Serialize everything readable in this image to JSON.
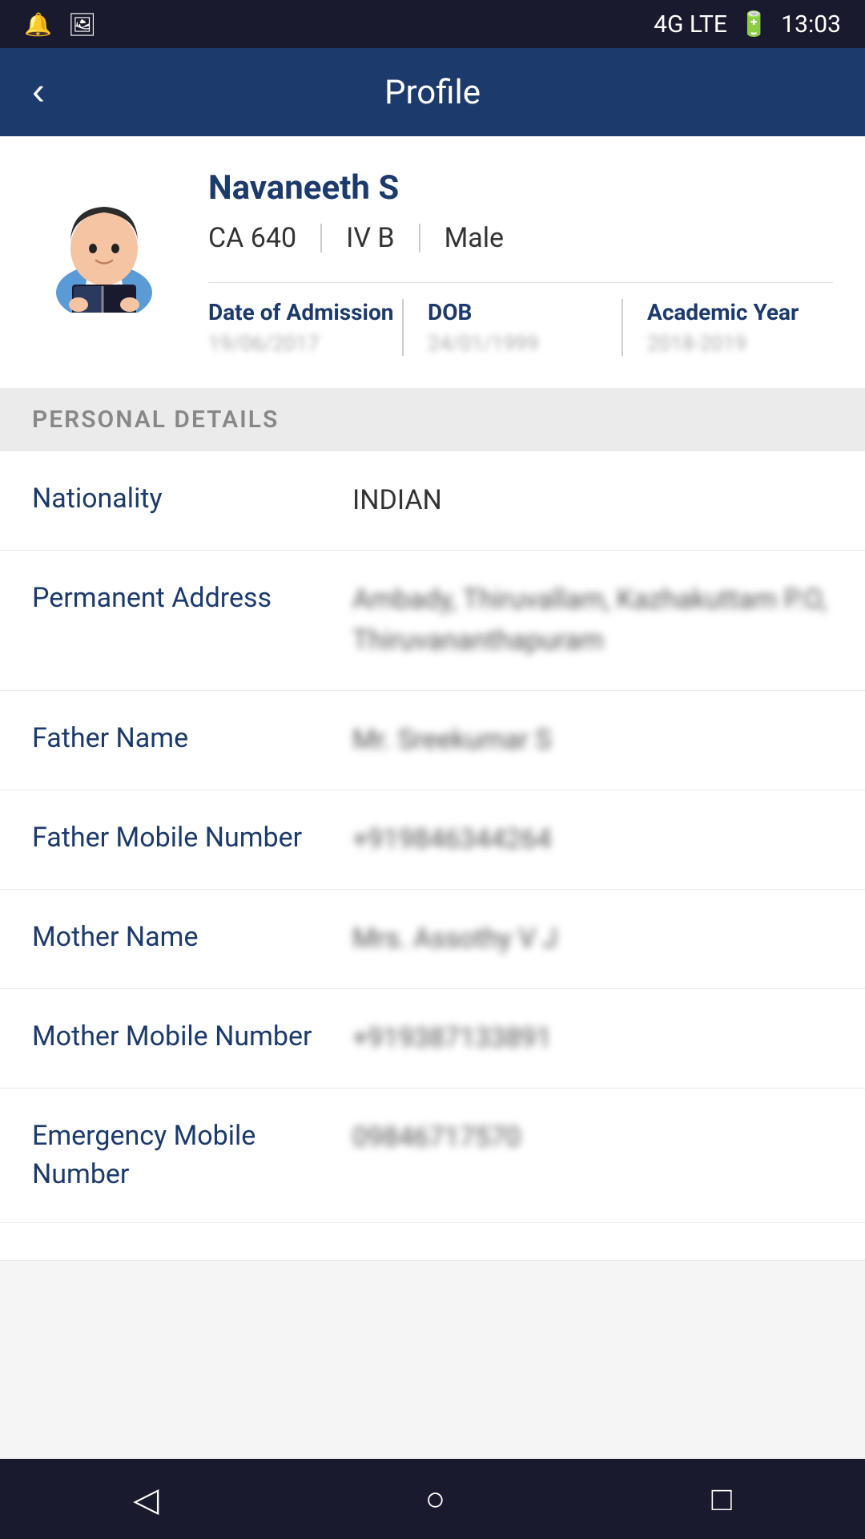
{
  "statusBar": {
    "time": "13:03",
    "signal": "4G LTE"
  },
  "appBar": {
    "title": "Profile",
    "backLabel": "‹"
  },
  "profile": {
    "name": "Navaneeth S",
    "roll": "CA 640",
    "section": "IV B",
    "gender": "Male",
    "stats": [
      {
        "label": "Date of Admission",
        "value": "19/06/2017"
      },
      {
        "label": "DOB",
        "value": "24/01/1999"
      },
      {
        "label": "Academic Year",
        "value": "2018-2019"
      }
    ]
  },
  "personalDetails": {
    "sectionTitle": "PERSONAL DETAILS",
    "rows": [
      {
        "label": "Nationality",
        "value": "INDIAN",
        "blurred": false
      },
      {
        "label": "Permanent Address",
        "value": "Ambady, Thiruvallam,\nKazhakuttam P.O,\nThiruvananthapuram",
        "blurred": true
      },
      {
        "label": "Father Name",
        "value": "Mr. Sreekumar S",
        "blurred": true
      },
      {
        "label": "Father Mobile Number",
        "value": "+919846344264",
        "blurred": true
      },
      {
        "label": "Mother Name",
        "value": "Mrs. Assothy V J",
        "blurred": true
      },
      {
        "label": "Mother Mobile Number",
        "value": "+919387133891",
        "blurred": true
      },
      {
        "label": "Emergency Mobile Number",
        "value": "09846717570",
        "blurred": true
      }
    ]
  },
  "navBar": {
    "back": "◁",
    "home": "○",
    "recent": "□"
  }
}
